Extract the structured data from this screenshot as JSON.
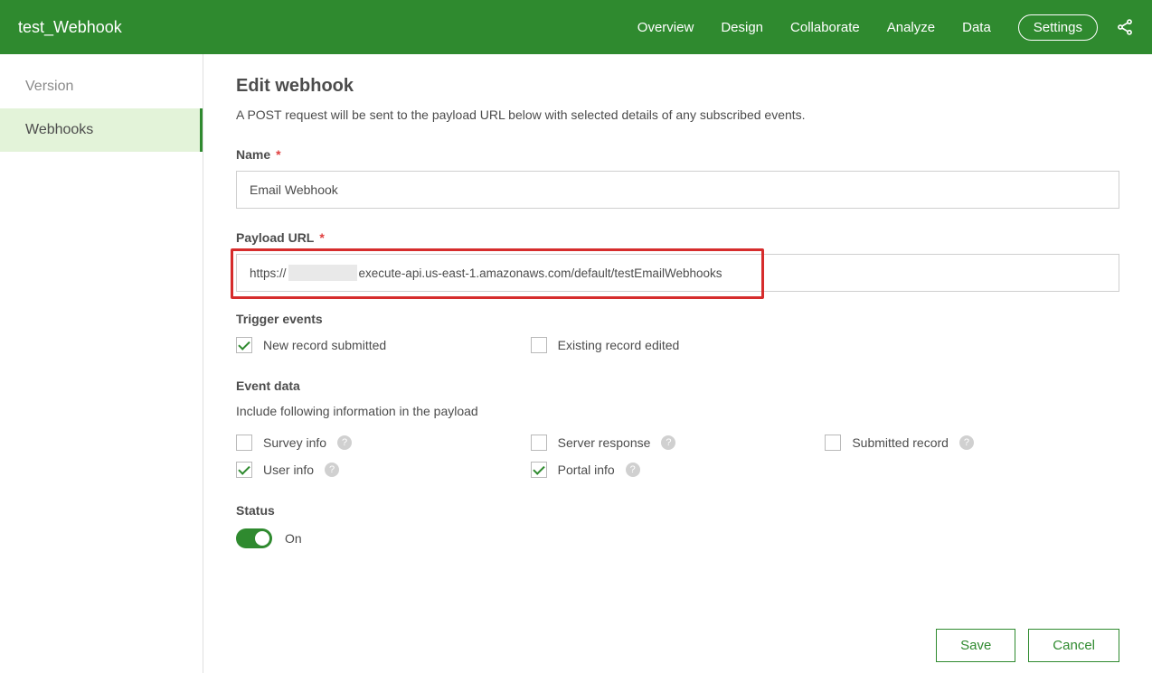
{
  "header": {
    "title": "test_Webhook",
    "nav": [
      "Overview",
      "Design",
      "Collaborate",
      "Analyze",
      "Data",
      "Settings"
    ]
  },
  "sidebar": {
    "items": [
      "Version",
      "Webhooks"
    ],
    "active_index": 1
  },
  "page": {
    "title": "Edit webhook",
    "description": "A POST request will be sent to the payload URL below with selected details of any subscribed events."
  },
  "form": {
    "name_label": "Name",
    "name_value": "Email Webhook",
    "payload_label": "Payload URL",
    "payload_prefix": "https://",
    "payload_suffix": "execute-api.us-east-1.amazonaws.com/default/testEmailWebhooks"
  },
  "triggers": {
    "label": "Trigger events",
    "new_record": {
      "label": "New record submitted",
      "checked": true
    },
    "existing_record": {
      "label": "Existing record edited",
      "checked": false
    }
  },
  "event_data": {
    "label": "Event data",
    "sub": "Include following information in the payload",
    "survey_info": {
      "label": "Survey info",
      "checked": false
    },
    "server_response": {
      "label": "Server response",
      "checked": false
    },
    "submitted_record": {
      "label": "Submitted record",
      "checked": false
    },
    "user_info": {
      "label": "User info",
      "checked": true
    },
    "portal_info": {
      "label": "Portal info",
      "checked": true
    }
  },
  "status": {
    "label": "Status",
    "value_label": "On",
    "on": true
  },
  "buttons": {
    "save": "Save",
    "cancel": "Cancel"
  }
}
